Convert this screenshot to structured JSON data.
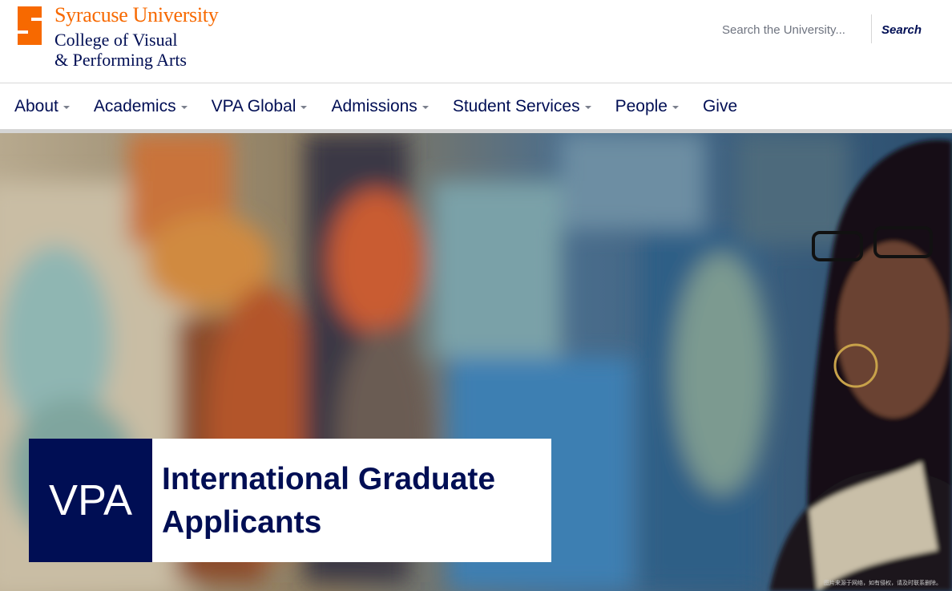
{
  "header": {
    "university_name": "Syracuse University",
    "college_line1": "College of Visual",
    "college_line2": "& Performing Arts",
    "logo_icon": "syracuse-s-icon"
  },
  "search": {
    "placeholder": "Search the University...",
    "button_label": "Search"
  },
  "nav": {
    "items": [
      {
        "label": "About",
        "dropdown": true
      },
      {
        "label": "Academics",
        "dropdown": true
      },
      {
        "label": "VPA Global",
        "dropdown": true
      },
      {
        "label": "Admissions",
        "dropdown": true
      },
      {
        "label": "Student Services",
        "dropdown": true
      },
      {
        "label": "People",
        "dropdown": true
      },
      {
        "label": "Give",
        "dropdown": false
      }
    ]
  },
  "hero": {
    "badge_text": "VPA",
    "title": "International Graduate Applicants",
    "watermark": "图片来源于网络，如有侵权，请及时联系删除。"
  },
  "colors": {
    "brand_orange": "#f76900",
    "brand_navy": "#000e54"
  }
}
